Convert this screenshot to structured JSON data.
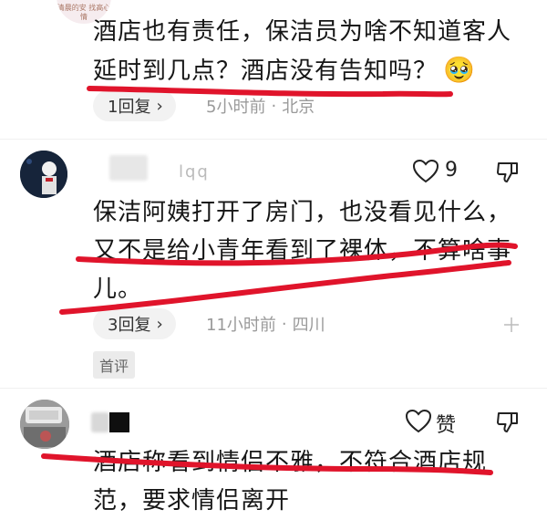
{
  "comments": [
    {
      "text_lines": [
        "酒店也有责任，保洁员为啥不知道客人",
        "延时到几点？酒店没有告知吗？"
      ],
      "emoji": "🥹",
      "replies": "1回复",
      "time": "5小时前",
      "location": "北京"
    },
    {
      "username": "lqq",
      "likes": "9",
      "text_lines": [
        "保洁阿姨打开了房门，也没看见什么，",
        "又不是给小青年看到了裸体，不算啥事",
        "儿。"
      ],
      "replies": "3回复",
      "time": "11小时前",
      "location": "四川",
      "badge": "首评"
    },
    {
      "likes": "赞",
      "text_lines": [
        "酒店称看到情侣不雅，不符合酒店规",
        "范，要求情侣离开"
      ]
    }
  ],
  "avatar1_text": "清晨的安 找高心情",
  "colors": {
    "annotation_red": "#e0142b",
    "pill_bg": "#f2f2f2",
    "meta": "#9a9a9a"
  }
}
